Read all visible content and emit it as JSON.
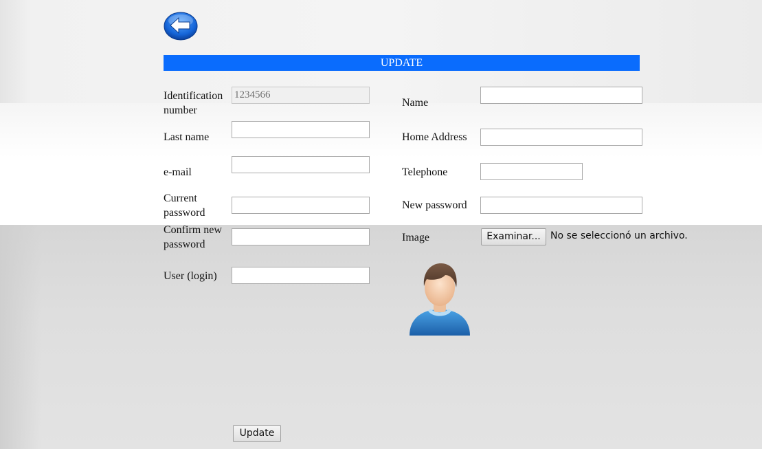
{
  "header": {
    "back_icon": "back-arrow-icon",
    "title": "UPDATE",
    "accent_color": "#0a6cfd"
  },
  "form": {
    "left": {
      "id_label": "Identification number",
      "id_value": "1234566",
      "lastname_label": "Last name",
      "lastname_value": "",
      "email_label": "e-mail",
      "email_value": "",
      "current_password_label": "Current password",
      "current_password_value": "",
      "confirm_password_label": "Confirm new password",
      "confirm_password_value": "",
      "user_label": "User (login)",
      "user_value": ""
    },
    "right": {
      "name_label": "Name",
      "name_value": "",
      "address_label": "Home Address",
      "address_value": "",
      "telephone_label": "Telephone",
      "telephone_value": "",
      "new_password_label": "New password",
      "new_password_value": "",
      "image_label": "Image",
      "file_button_label": "Examinar...",
      "file_status": "No se seleccionó un archivo.",
      "avatar_icon": "user-avatar-icon"
    },
    "submit_label": "Update"
  }
}
